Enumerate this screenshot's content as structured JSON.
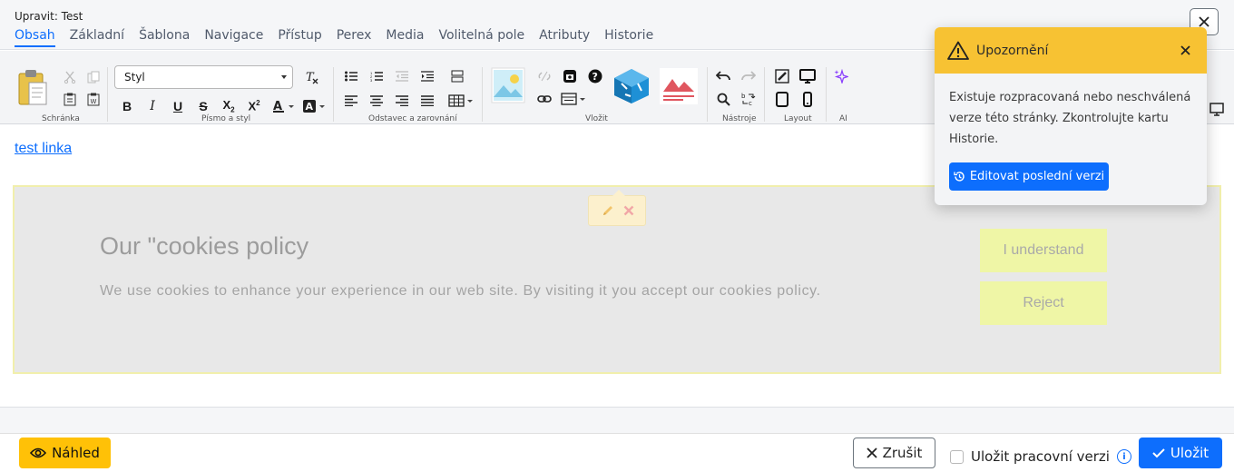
{
  "window": {
    "title": "Upravit: Test"
  },
  "tabs": [
    {
      "label": "Obsah",
      "active": true
    },
    {
      "label": "Základní"
    },
    {
      "label": "Šablona"
    },
    {
      "label": "Navigace"
    },
    {
      "label": "Přístup"
    },
    {
      "label": "Perex"
    },
    {
      "label": "Media"
    },
    {
      "label": "Volitelná pole"
    },
    {
      "label": "Atributy"
    },
    {
      "label": "Historie"
    }
  ],
  "toolbar": {
    "style_select": "Styl",
    "groups": {
      "clipboard": "Schránka",
      "font": "Písmo a styl",
      "paragraph": "Odstavec a zarovnání",
      "insert": "Vložit",
      "tools": "Nástroje",
      "layout": "Layout",
      "ai": "AI"
    }
  },
  "content": {
    "link_text": "test linka",
    "cookie_title": "Our \"cookies policy",
    "cookie_text": "We use cookies to enhance your experience in our web site. By visiting it you accept our cookies policy.",
    "btn_understand": "I understand",
    "btn_reject": "Reject"
  },
  "toast": {
    "title": "Upozornění",
    "body": "Existuje rozpracovaná nebo neschválená verze této stránky. Zkontrolujte kartu Historie.",
    "button": "Editovat poslední verzi"
  },
  "footer": {
    "preview": "Náhled",
    "cancel": "Zrušit",
    "save_draft": "Uložit pracovní verzi",
    "save": "Uložit"
  },
  "colors": {
    "accent": "#0d6efd",
    "warning": "#f7c233",
    "preview_btn": "#ffc107"
  }
}
